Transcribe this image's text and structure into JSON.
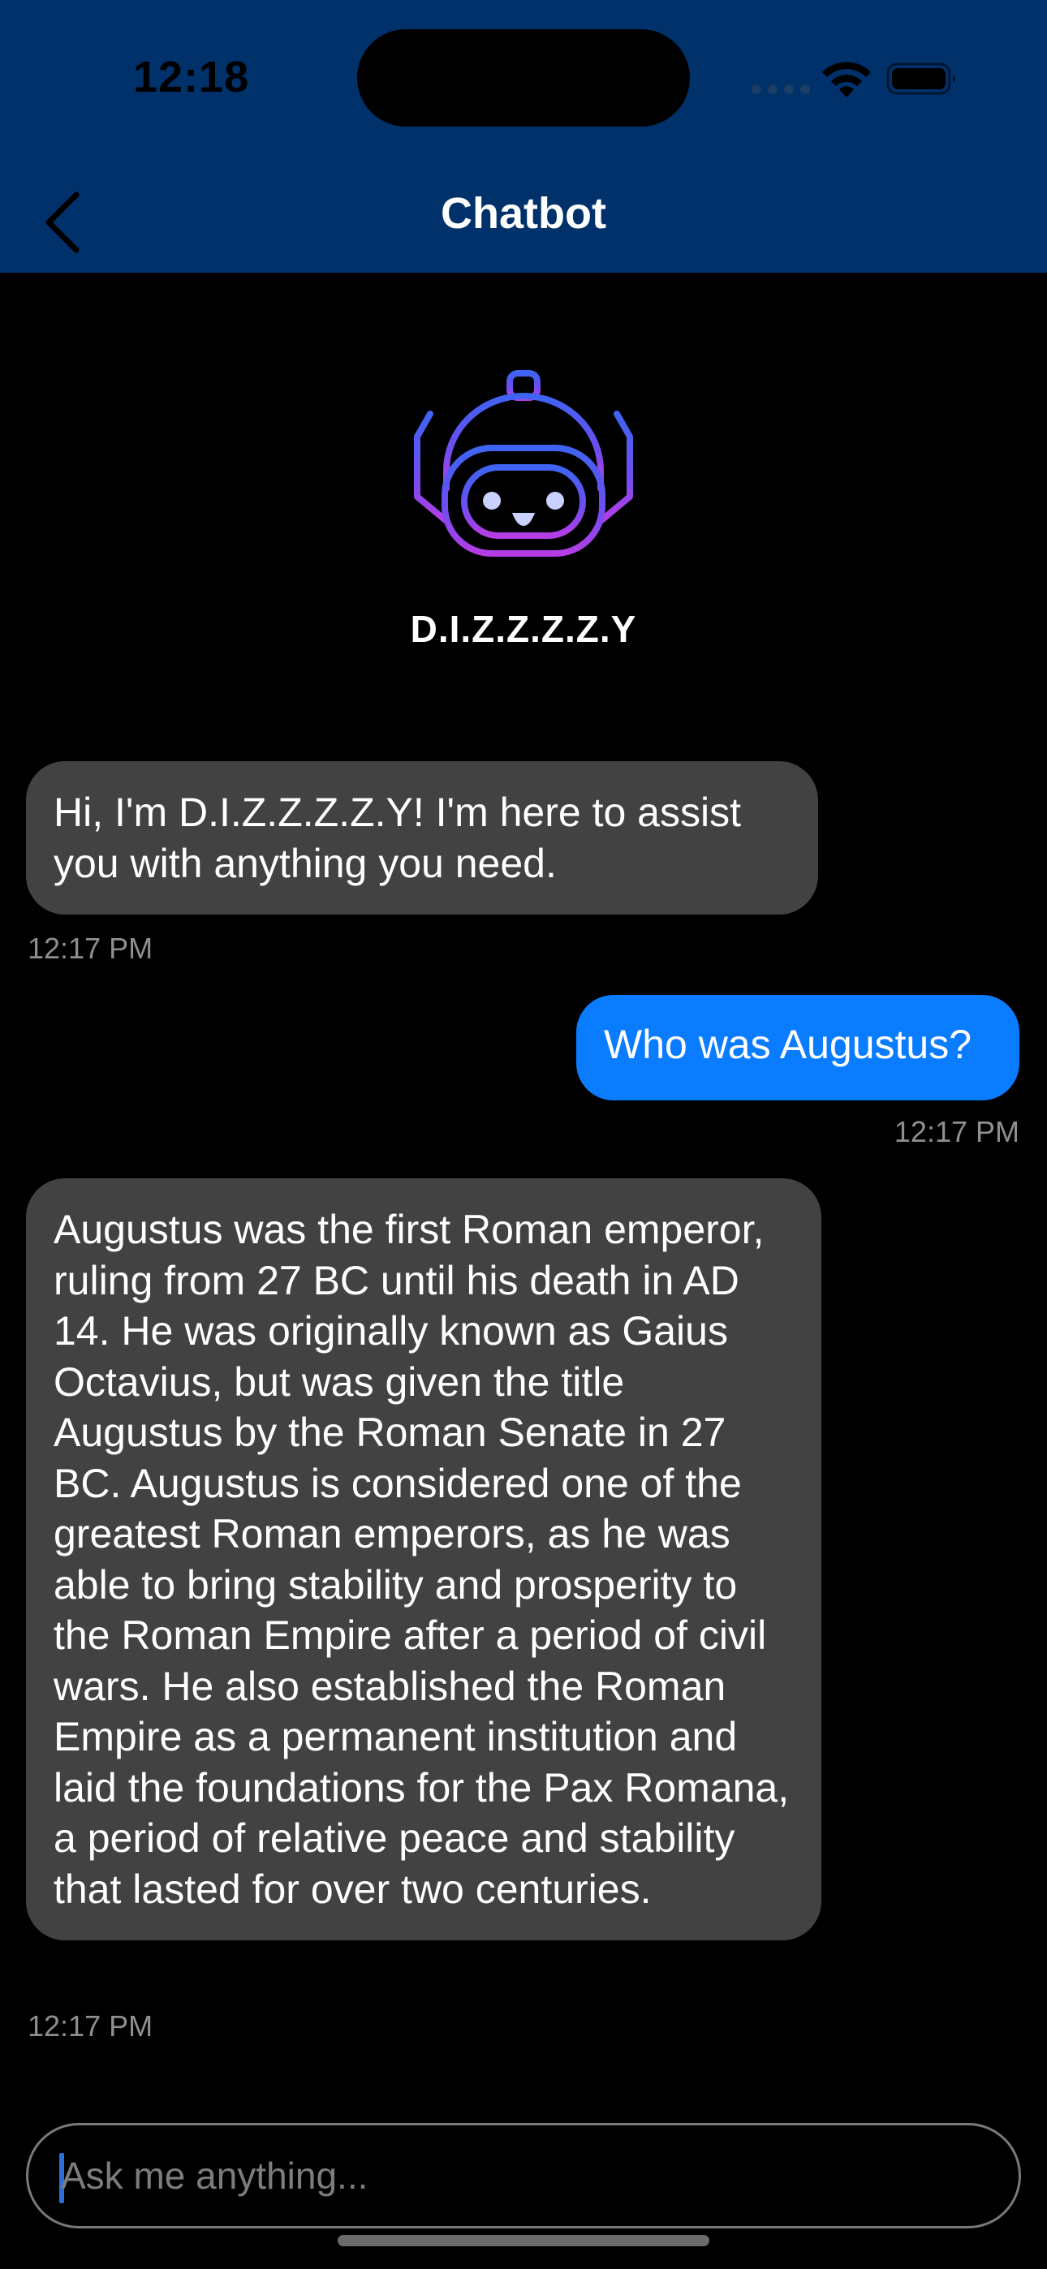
{
  "status_bar": {
    "time": "12:18",
    "icons": [
      "signal-icon",
      "wifi-icon",
      "battery-icon"
    ]
  },
  "header": {
    "title": "Chatbot",
    "back_icon": "chevron-left-icon",
    "background_color": "#00316b"
  },
  "bot": {
    "name": "D.I.Z.Z.Z.Z.Y",
    "avatar_icon": "robot-icon"
  },
  "messages": [
    {
      "sender": "bot",
      "text": "Hi, I'm D.I.Z.Z.Z.Z.Y! I'm here to assist you with anything you need.",
      "time": "12:17 PM"
    },
    {
      "sender": "user",
      "text": "Who was Augustus?",
      "time": "12:17 PM"
    },
    {
      "sender": "bot",
      "text": "Augustus was the first Roman emperor, ruling from 27 BC until his death in AD 14. He was originally known as Gaius Octavius, but was given the title Augustus by the Roman Senate in 27 BC. Augustus is considered one of the greatest Roman emperors, as he was able to bring stability and prosperity to the Roman Empire after a period of civil wars. He also established the Roman Empire as a permanent institution and laid the foundations for the Pax Romana, a period of relative peace and stability that lasted for over two centuries.",
      "time": "12:17 PM"
    }
  ],
  "input": {
    "placeholder": "Ask me anything...",
    "value": ""
  },
  "colors": {
    "bot_bubble": "#424242",
    "user_bubble": "#0a7cff",
    "timestamp": "#8e8e93"
  }
}
